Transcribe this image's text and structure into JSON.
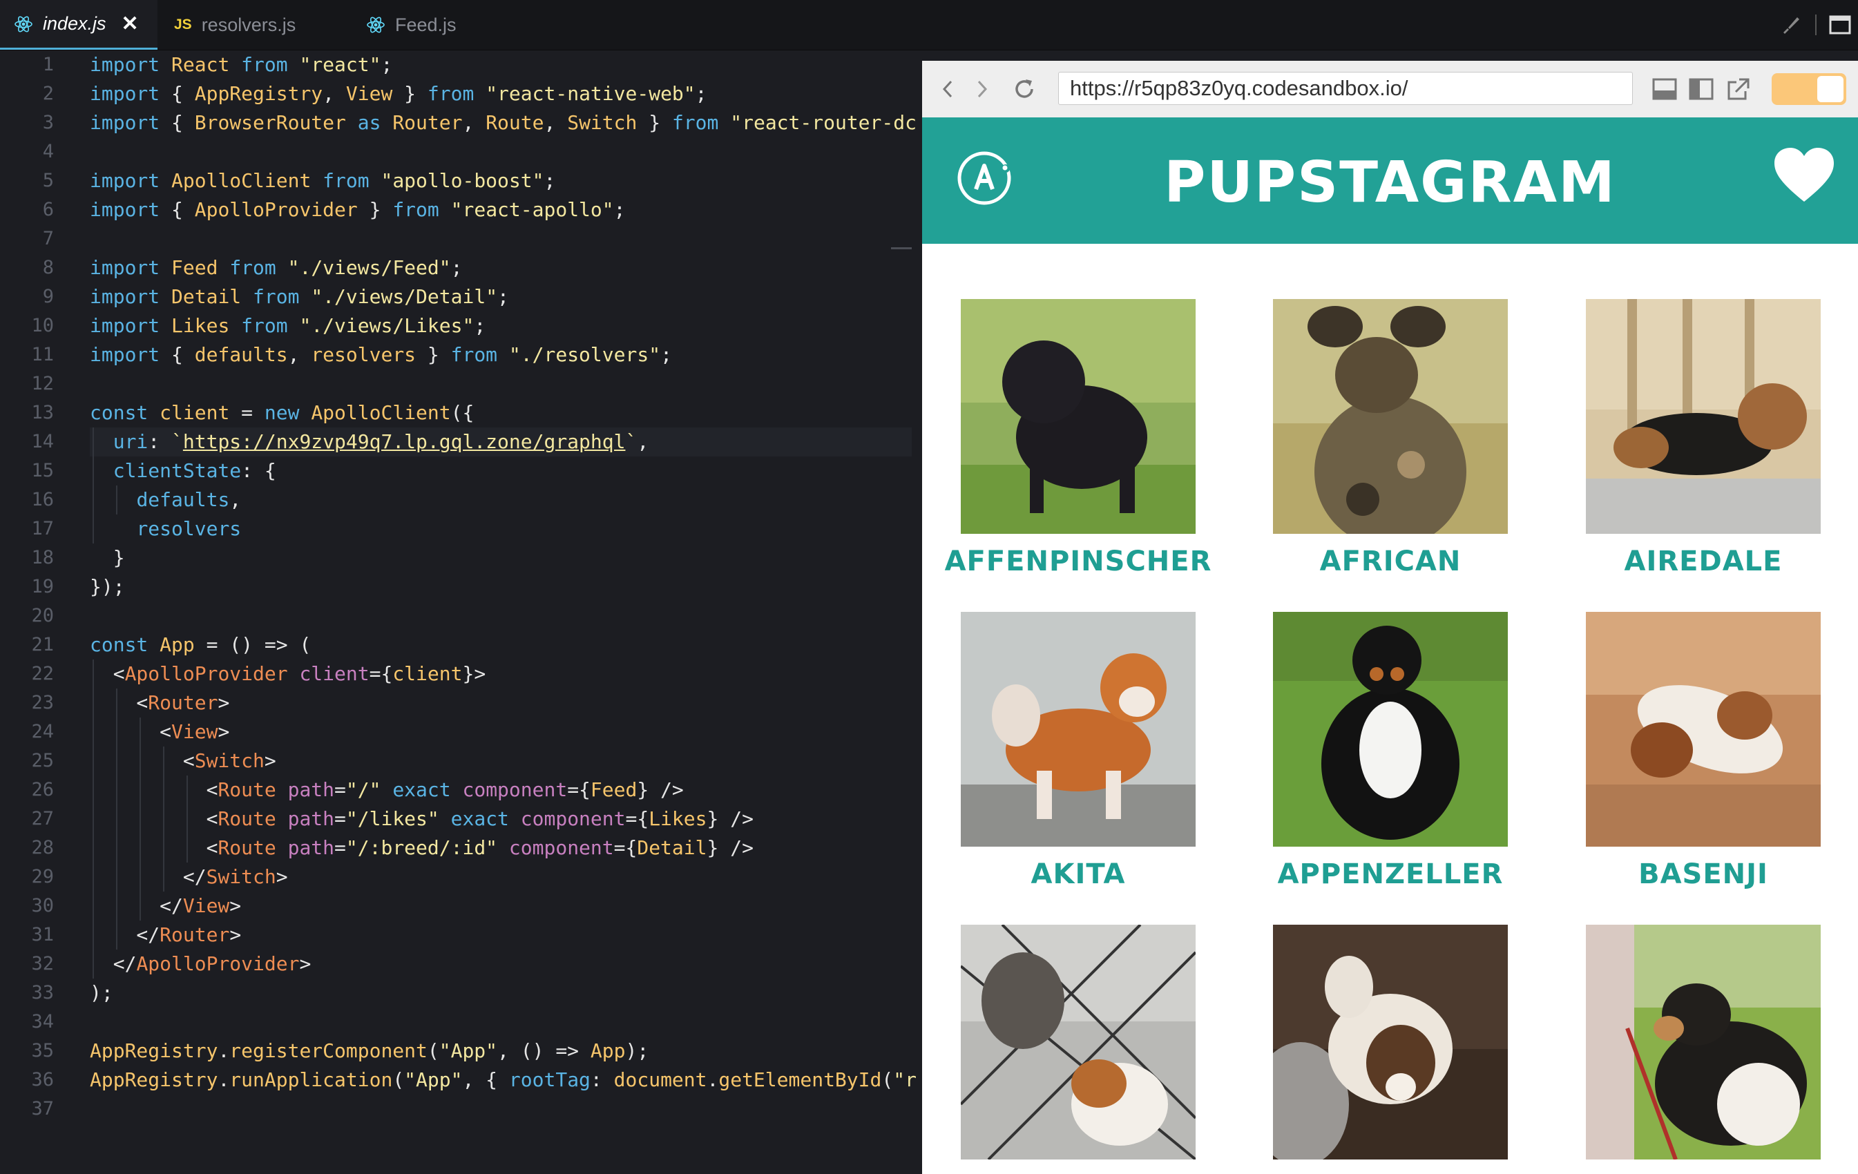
{
  "tabs": [
    {
      "label": "index.js",
      "active": true,
      "icon": "react-icon"
    },
    {
      "label": "resolvers.js",
      "active": false,
      "icon": "js-icon"
    },
    {
      "label": "Feed.js",
      "active": false,
      "icon": "react-icon"
    }
  ],
  "tab_js_badge": "JS",
  "editor": {
    "line_numbers": [
      "1",
      "2",
      "3",
      "4",
      "5",
      "6",
      "7",
      "8",
      "9",
      "10",
      "11",
      "12",
      "13",
      "14",
      "15",
      "16",
      "17",
      "18",
      "19",
      "20",
      "21",
      "22",
      "23",
      "24",
      "25",
      "26",
      "27",
      "28",
      "29",
      "30",
      "31",
      "32",
      "33",
      "34",
      "35",
      "36",
      "37"
    ],
    "lines": [
      "import React from \"react\";",
      "import { AppRegistry, View } from \"react-native-web\";",
      "import { BrowserRouter as Router, Route, Switch } from \"react-router-dc",
      "",
      "import ApolloClient from \"apollo-boost\";",
      "import { ApolloProvider } from \"react-apollo\";",
      "",
      "import Feed from \"./views/Feed\";",
      "import Detail from \"./views/Detail\";",
      "import Likes from \"./views/Likes\";",
      "import { defaults, resolvers } from \"./resolvers\";",
      "",
      "const client = new ApolloClient({",
      "  uri: `https://nx9zvp49q7.lp.gql.zone/graphql`,",
      "  clientState: {",
      "    defaults,",
      "    resolvers",
      "  }",
      "});",
      "",
      "const App = () => (",
      "  <ApolloProvider client={client}>",
      "    <Router>",
      "      <View>",
      "        <Switch>",
      "          <Route path=\"/\" exact component={Feed} />",
      "          <Route path=\"/likes\" exact component={Likes} />",
      "          <Route path=\"/:breed/:id\" component={Detail} />",
      "        </Switch>",
      "      </View>",
      "    </Router>",
      "  </ApolloProvider>",
      ");",
      "",
      "AppRegistry.registerComponent(\"App\", () => App);",
      "AppRegistry.runApplication(\"App\", { rootTag: document.getElementById(\"r",
      ""
    ]
  },
  "browser": {
    "url": "https://r5qp83z0yq.codesandbox.io/",
    "title": "PUPSTAGRAM",
    "breeds": [
      "Affenpinscher",
      "African",
      "Airedale",
      "Akita",
      "Appenzeller",
      "Basenji",
      "",
      "",
      ""
    ]
  },
  "colors": {
    "appbar": "#22a196",
    "breed_label": "#1f9e93",
    "toggle": "#fbc779",
    "tab_accent": "#4fb0d8"
  }
}
